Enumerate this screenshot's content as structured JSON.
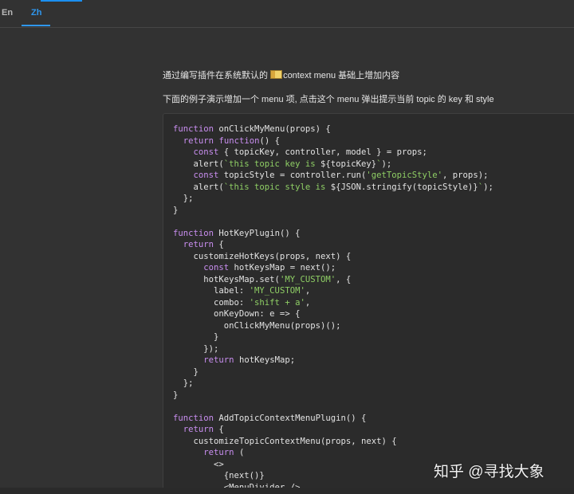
{
  "tabs": [
    {
      "label": "En",
      "active": false
    },
    {
      "label": "Zh",
      "active": true
    }
  ],
  "intro": {
    "line1_before": "通过编写插件在系统默认的 ",
    "line1_emoji": "menu-icon",
    "line1_after": "context menu 基础上增加内容",
    "line2": "下面的例子演示增加一个 menu 项, 点击这个 menu 弹出提示当前 topic 的 key 和 style"
  },
  "code": {
    "lines": [
      "function onClickMyMenu(props) {",
      "  return function() {",
      "    const { topicKey, controller, model } = props;",
      "    alert(`this topic key is ${topicKey}`);",
      "    const topicStyle = controller.run('getTopicStyle', props);",
      "    alert(`this topic style is ${JSON.stringify(topicStyle)}`);",
      "  };",
      "}",
      "",
      "function HotKeyPlugin() {",
      "  return {",
      "    customizeHotKeys(props, next) {",
      "      const hotKeysMap = next();",
      "      hotKeysMap.set('MY_CUSTOM', {",
      "        label: 'MY_CUSTOM',",
      "        combo: 'shift + a',",
      "        onKeyDown: e => {",
      "          onClickMyMenu(props)();",
      "        }",
      "      });",
      "      return hotKeysMap;",
      "    }",
      "  };",
      "}",
      "",
      "function AddTopicContextMenuPlugin() {",
      "  return {",
      "    customizeTopicContextMenu(props, next) {",
      "      return (",
      "        <>",
      "          {next()}",
      "          <MenuDivider />"
    ]
  },
  "watermark": "知乎 @寻找大象",
  "colors": {
    "background": "#323232",
    "accent": "#2f97ee",
    "code_background": "#2b2b2b",
    "keyword": "#c98ef0",
    "string": "#8fcf65"
  }
}
